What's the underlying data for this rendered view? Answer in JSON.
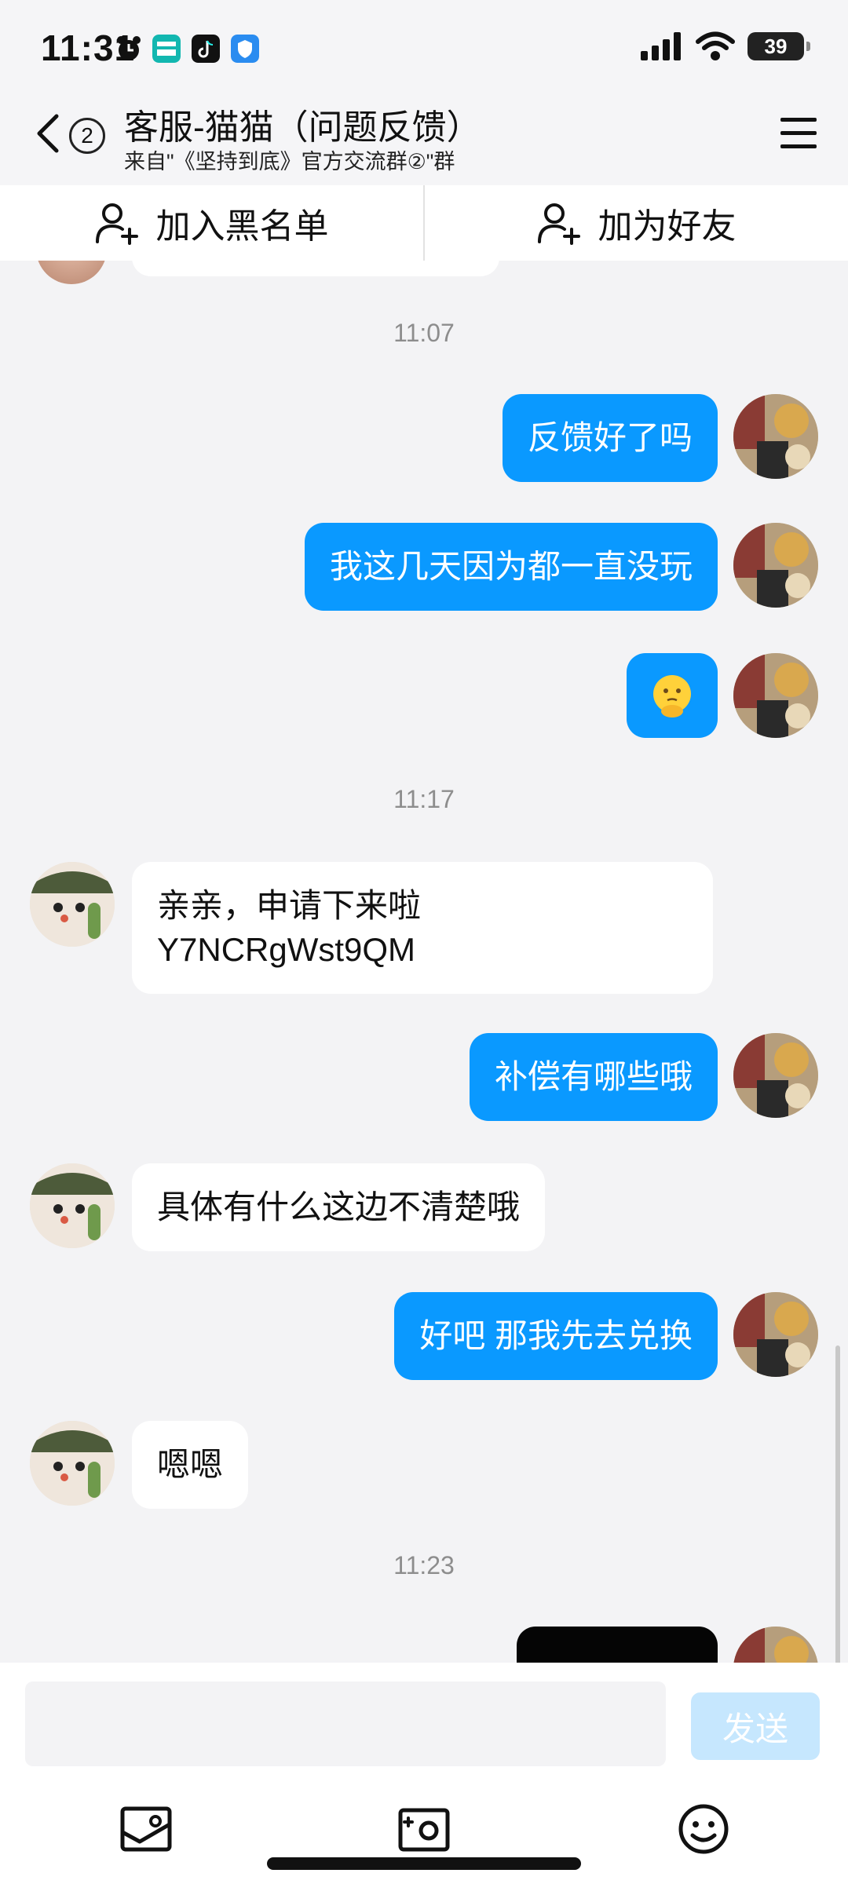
{
  "status_bar": {
    "time": "11:31",
    "battery": "39",
    "app_icons": [
      "alarm-icon",
      "boss-zhipin-app-icon",
      "douyin-app-icon",
      "shield-app-icon"
    ]
  },
  "header": {
    "unread_count": "2",
    "title": "客服-猫猫（问题反馈）",
    "subtitle": "来自\"《坚持到底》官方交流群②\"群"
  },
  "actions": {
    "blacklist": "加入黑名单",
    "add_friend": "加为好友"
  },
  "chat": {
    "timestamps": [
      "11:07",
      "11:17",
      "11:23"
    ],
    "messages": [
      {
        "from": "me",
        "text": "反馈好了吗"
      },
      {
        "from": "me",
        "text": "我这几天因为都一直没玩"
      },
      {
        "from": "me",
        "emoji": "thinking-face-emoji"
      },
      {
        "from": "them",
        "lines": [
          "亲亲，申请下来啦",
          "Y7NCRgWst9QM"
        ]
      },
      {
        "from": "me",
        "text": "补偿有哪些哦"
      },
      {
        "from": "them",
        "text": "具体有什么这边不清楚哦"
      },
      {
        "from": "me",
        "text": "好吧 那我先去兑换"
      },
      {
        "from": "them",
        "text": "嗯嗯"
      }
    ]
  },
  "input": {
    "placeholder": "",
    "send": "发送"
  },
  "colors": {
    "my_bubble": "#0a99ff",
    "their_bubble": "#ffffff",
    "background": "#f3f3f5",
    "send_button_disabled": "#c6e7fe"
  }
}
